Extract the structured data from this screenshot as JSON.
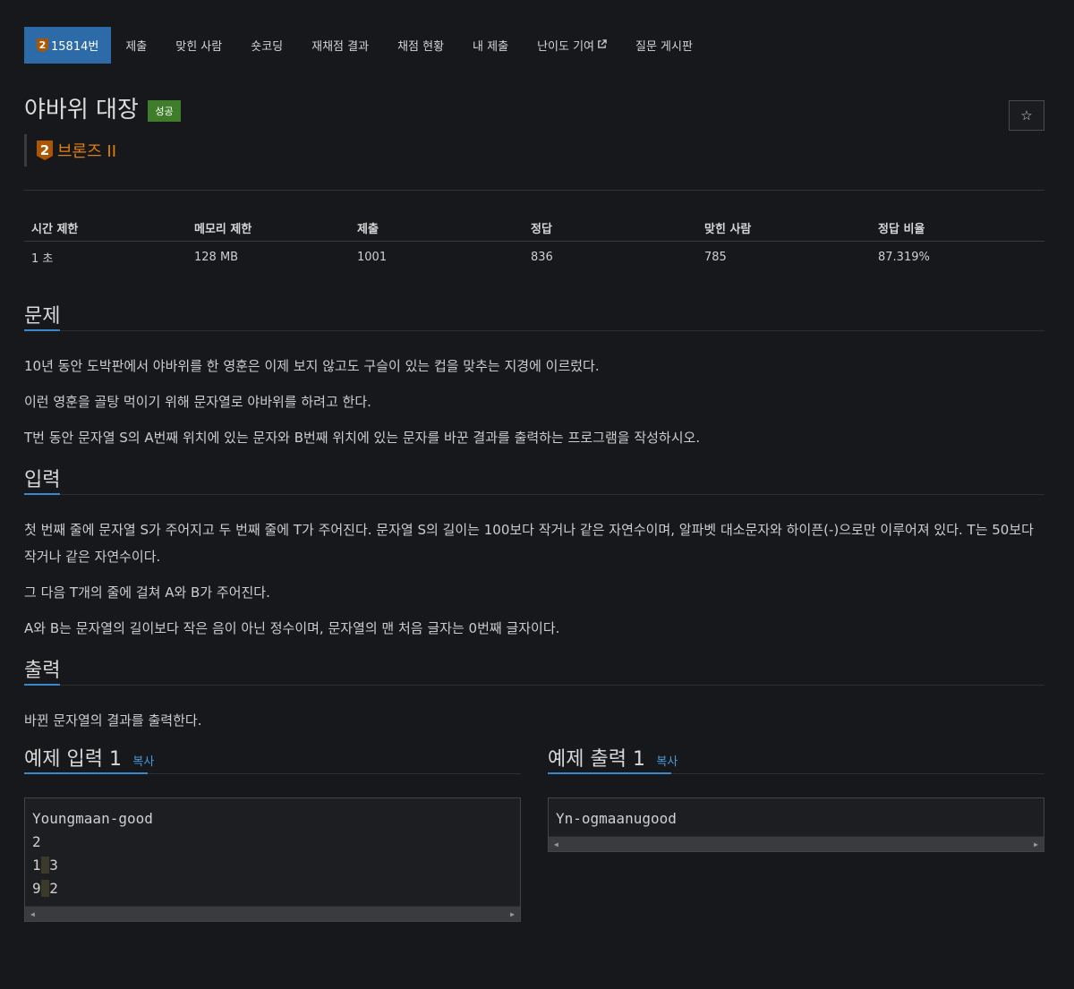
{
  "tabs": [
    {
      "label": "15814번",
      "tier_num": "2",
      "active": true
    },
    {
      "label": "제출"
    },
    {
      "label": "맞힌 사람"
    },
    {
      "label": "숏코딩"
    },
    {
      "label": "재채점 결과"
    },
    {
      "label": "채점 현황"
    },
    {
      "label": "내 제출"
    },
    {
      "label": "난이도 기여"
    },
    {
      "label": "질문 게시판"
    }
  ],
  "problem": {
    "title": "야바위 대장",
    "status_label": "성공",
    "tier_num": "2",
    "tier_name": "브론즈 II",
    "star": "☆"
  },
  "stats": {
    "headers": [
      "시간 제한",
      "메모리 제한",
      "제출",
      "정답",
      "맞힌 사람",
      "정답 비율"
    ],
    "values": [
      "1 초",
      "128 MB",
      "1001",
      "836",
      "785",
      "87.319%"
    ]
  },
  "sections": {
    "problem": {
      "heading": "문제",
      "paragraphs": [
        "10년 동안 도박판에서 야바위를 한 영훈은 이제 보지 않고도 구슬이 있는 컵을 맞추는 지경에 이르렀다.",
        "이런 영훈을 골탕 먹이기 위해 문자열로 야바위를 하려고 한다.",
        "T번 동안 문자열 S의 A번째 위치에 있는 문자와 B번째 위치에 있는 문자를 바꾼 결과를 출력하는 프로그램을 작성하시오."
      ]
    },
    "input": {
      "heading": "입력",
      "paragraphs": [
        "첫 번째 줄에 문자열 S가 주어지고 두 번째 줄에 T가 주어진다. 문자열 S의 길이는 100보다 작거나 같은 자연수이며, 알파벳 대소문자와 하이픈(-)으로만 이루어져 있다. T는 50보다 작거나 같은 자연수이다.",
        "그 다음 T개의 줄에 걸쳐 A와 B가 주어진다.",
        "A와 B는 문자열의 길이보다 작은 음이 아닌 정수이며, 문자열의 맨 처음 글자는 0번째 글자이다."
      ]
    },
    "output": {
      "heading": "출력",
      "paragraphs": [
        "바뀐 문자열의 결과를 출력한다."
      ]
    }
  },
  "samples": {
    "input": {
      "heading": "예제 입력 1",
      "copy_label": "복사",
      "line1": "Youngmaan-good",
      "line2": "2",
      "line3a": "1",
      "line3b": "3",
      "line4a": "9",
      "line4b": "2"
    },
    "output": {
      "heading": "예제 출력 1",
      "copy_label": "복사",
      "line1": "Yn-ogmaanugood"
    }
  },
  "colors": {
    "background": "#17181b",
    "active_tab": "#2c6aa8",
    "success_label": "#3f7d2a",
    "tier_bronze": "#ad5600",
    "tier_text": "#e07e12",
    "accent_underline": "#3a88cc"
  }
}
